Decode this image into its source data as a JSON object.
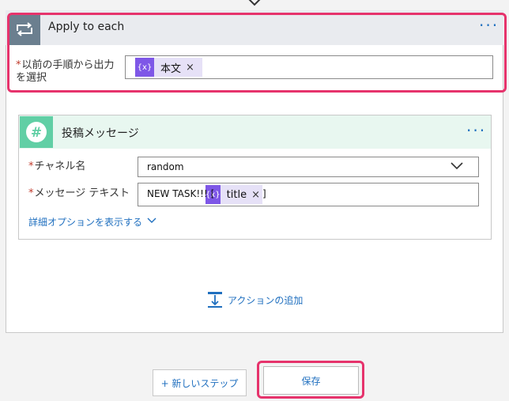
{
  "apply_to_each": {
    "title": "Apply to each",
    "more_label": "···",
    "field_label": "以前の手順から出力を選択",
    "required_mark": "*",
    "token": {
      "label": "本文",
      "icon": "expression-icon",
      "icon_glyph": "{x}",
      "remove": "×"
    }
  },
  "slack_action": {
    "title": "投稿メッセージ",
    "more_label": "···",
    "channel": {
      "label": "チャネル名",
      "value": "random"
    },
    "message": {
      "label": "メッセージ テキスト",
      "prefix": "NEW TASK!!! [",
      "suffix": "]",
      "token": {
        "label": "title",
        "icon": "expression-icon",
        "icon_glyph": "{x}",
        "remove": "×"
      }
    },
    "advanced_options": "詳細オプションを表示する"
  },
  "add_action_label": "アクションの追加",
  "footer": {
    "new_step_label": "+ 新しいステップ",
    "save_label": "保存"
  },
  "colors": {
    "highlight": "#e6336c",
    "link": "#1f6fbf",
    "token_icon": "#7e57e7",
    "slack_icon": "#61cfa5"
  }
}
